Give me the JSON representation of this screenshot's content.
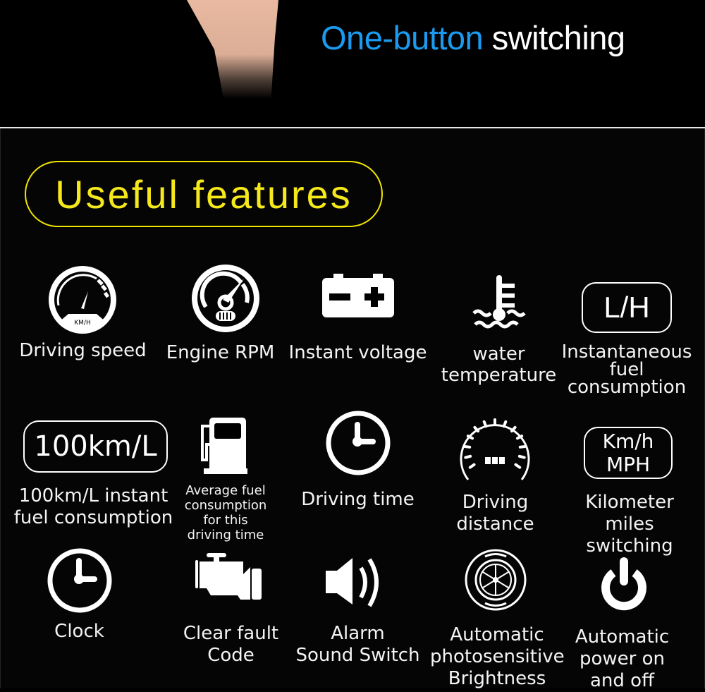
{
  "banner": {
    "headline_blue": "One-button",
    "headline_white": "switching"
  },
  "section": {
    "title": "Useful features",
    "accent_color": "#f2e600"
  },
  "features": [
    {
      "id": "driving-speed",
      "icon": "speedometer-icon",
      "icon_text": "KM/H",
      "label": "Driving speed"
    },
    {
      "id": "engine-rpm",
      "icon": "tachometer-icon",
      "label": "Engine RPM"
    },
    {
      "id": "instant-voltage",
      "icon": "battery-icon",
      "label": "Instant voltage"
    },
    {
      "id": "water-temperature",
      "icon": "coolant-temperature-icon",
      "label": "water\ntemperature"
    },
    {
      "id": "instantaneous-fuel",
      "icon": "lh-badge-icon",
      "icon_text": "L/H",
      "label": "Instantaneous\nfuel\nconsumption"
    },
    {
      "id": "100km-fuel",
      "icon": "100km-badge-icon",
      "icon_text": "100km/L",
      "label": "100km/L instant\nfuel consumption"
    },
    {
      "id": "average-fuel",
      "icon": "fuel-pump-icon",
      "label": "Average fuel\nconsumption\nfor this\ndriving time"
    },
    {
      "id": "driving-time",
      "icon": "clock-icon",
      "label": "Driving time"
    },
    {
      "id": "driving-distance",
      "icon": "odometer-icon",
      "label": "Driving\ndistance"
    },
    {
      "id": "km-miles",
      "icon": "kmh-mph-badge-icon",
      "icon_text_1": "Km/h",
      "icon_text_2": "MPH",
      "label": "Kilometer\nmiles switching"
    },
    {
      "id": "clock",
      "icon": "clock-icon",
      "label": "Clock"
    },
    {
      "id": "clear-fault",
      "icon": "engine-icon",
      "label": "Clear fault\nCode"
    },
    {
      "id": "alarm-sound",
      "icon": "speaker-icon",
      "label": "Alarm\nSound Switch"
    },
    {
      "id": "auto-brightness",
      "icon": "aperture-icon",
      "label": "Automatic\nphotosensitive\nBrightness"
    },
    {
      "id": "auto-power",
      "icon": "power-icon",
      "label": "Automatic\npower on\nand off"
    }
  ]
}
